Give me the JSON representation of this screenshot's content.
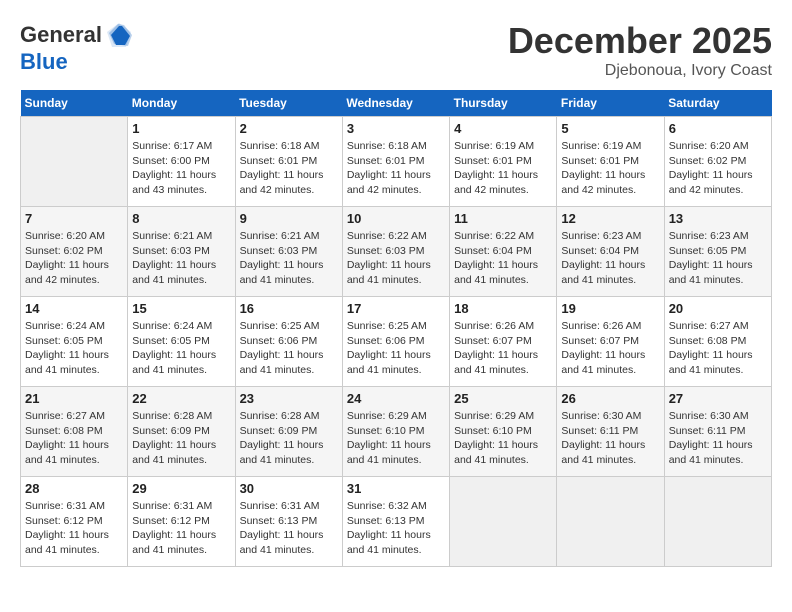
{
  "header": {
    "logo_line1": "General",
    "logo_line2": "Blue",
    "month_title": "December 2025",
    "subtitle": "Djebonoua, Ivory Coast"
  },
  "days_of_week": [
    "Sunday",
    "Monday",
    "Tuesday",
    "Wednesday",
    "Thursday",
    "Friday",
    "Saturday"
  ],
  "weeks": [
    [
      {
        "day": "",
        "info": ""
      },
      {
        "day": "1",
        "info": "Sunrise: 6:17 AM\nSunset: 6:00 PM\nDaylight: 11 hours\nand 43 minutes."
      },
      {
        "day": "2",
        "info": "Sunrise: 6:18 AM\nSunset: 6:01 PM\nDaylight: 11 hours\nand 42 minutes."
      },
      {
        "day": "3",
        "info": "Sunrise: 6:18 AM\nSunset: 6:01 PM\nDaylight: 11 hours\nand 42 minutes."
      },
      {
        "day": "4",
        "info": "Sunrise: 6:19 AM\nSunset: 6:01 PM\nDaylight: 11 hours\nand 42 minutes."
      },
      {
        "day": "5",
        "info": "Sunrise: 6:19 AM\nSunset: 6:01 PM\nDaylight: 11 hours\nand 42 minutes."
      },
      {
        "day": "6",
        "info": "Sunrise: 6:20 AM\nSunset: 6:02 PM\nDaylight: 11 hours\nand 42 minutes."
      }
    ],
    [
      {
        "day": "7",
        "info": "Sunrise: 6:20 AM\nSunset: 6:02 PM\nDaylight: 11 hours\nand 42 minutes."
      },
      {
        "day": "8",
        "info": "Sunrise: 6:21 AM\nSunset: 6:03 PM\nDaylight: 11 hours\nand 41 minutes."
      },
      {
        "day": "9",
        "info": "Sunrise: 6:21 AM\nSunset: 6:03 PM\nDaylight: 11 hours\nand 41 minutes."
      },
      {
        "day": "10",
        "info": "Sunrise: 6:22 AM\nSunset: 6:03 PM\nDaylight: 11 hours\nand 41 minutes."
      },
      {
        "day": "11",
        "info": "Sunrise: 6:22 AM\nSunset: 6:04 PM\nDaylight: 11 hours\nand 41 minutes."
      },
      {
        "day": "12",
        "info": "Sunrise: 6:23 AM\nSunset: 6:04 PM\nDaylight: 11 hours\nand 41 minutes."
      },
      {
        "day": "13",
        "info": "Sunrise: 6:23 AM\nSunset: 6:05 PM\nDaylight: 11 hours\nand 41 minutes."
      }
    ],
    [
      {
        "day": "14",
        "info": "Sunrise: 6:24 AM\nSunset: 6:05 PM\nDaylight: 11 hours\nand 41 minutes."
      },
      {
        "day": "15",
        "info": "Sunrise: 6:24 AM\nSunset: 6:05 PM\nDaylight: 11 hours\nand 41 minutes."
      },
      {
        "day": "16",
        "info": "Sunrise: 6:25 AM\nSunset: 6:06 PM\nDaylight: 11 hours\nand 41 minutes."
      },
      {
        "day": "17",
        "info": "Sunrise: 6:25 AM\nSunset: 6:06 PM\nDaylight: 11 hours\nand 41 minutes."
      },
      {
        "day": "18",
        "info": "Sunrise: 6:26 AM\nSunset: 6:07 PM\nDaylight: 11 hours\nand 41 minutes."
      },
      {
        "day": "19",
        "info": "Sunrise: 6:26 AM\nSunset: 6:07 PM\nDaylight: 11 hours\nand 41 minutes."
      },
      {
        "day": "20",
        "info": "Sunrise: 6:27 AM\nSunset: 6:08 PM\nDaylight: 11 hours\nand 41 minutes."
      }
    ],
    [
      {
        "day": "21",
        "info": "Sunrise: 6:27 AM\nSunset: 6:08 PM\nDaylight: 11 hours\nand 41 minutes."
      },
      {
        "day": "22",
        "info": "Sunrise: 6:28 AM\nSunset: 6:09 PM\nDaylight: 11 hours\nand 41 minutes."
      },
      {
        "day": "23",
        "info": "Sunrise: 6:28 AM\nSunset: 6:09 PM\nDaylight: 11 hours\nand 41 minutes."
      },
      {
        "day": "24",
        "info": "Sunrise: 6:29 AM\nSunset: 6:10 PM\nDaylight: 11 hours\nand 41 minutes."
      },
      {
        "day": "25",
        "info": "Sunrise: 6:29 AM\nSunset: 6:10 PM\nDaylight: 11 hours\nand 41 minutes."
      },
      {
        "day": "26",
        "info": "Sunrise: 6:30 AM\nSunset: 6:11 PM\nDaylight: 11 hours\nand 41 minutes."
      },
      {
        "day": "27",
        "info": "Sunrise: 6:30 AM\nSunset: 6:11 PM\nDaylight: 11 hours\nand 41 minutes."
      }
    ],
    [
      {
        "day": "28",
        "info": "Sunrise: 6:31 AM\nSunset: 6:12 PM\nDaylight: 11 hours\nand 41 minutes."
      },
      {
        "day": "29",
        "info": "Sunrise: 6:31 AM\nSunset: 6:12 PM\nDaylight: 11 hours\nand 41 minutes."
      },
      {
        "day": "30",
        "info": "Sunrise: 6:31 AM\nSunset: 6:13 PM\nDaylight: 11 hours\nand 41 minutes."
      },
      {
        "day": "31",
        "info": "Sunrise: 6:32 AM\nSunset: 6:13 PM\nDaylight: 11 hours\nand 41 minutes."
      },
      {
        "day": "",
        "info": ""
      },
      {
        "day": "",
        "info": ""
      },
      {
        "day": "",
        "info": ""
      }
    ]
  ]
}
